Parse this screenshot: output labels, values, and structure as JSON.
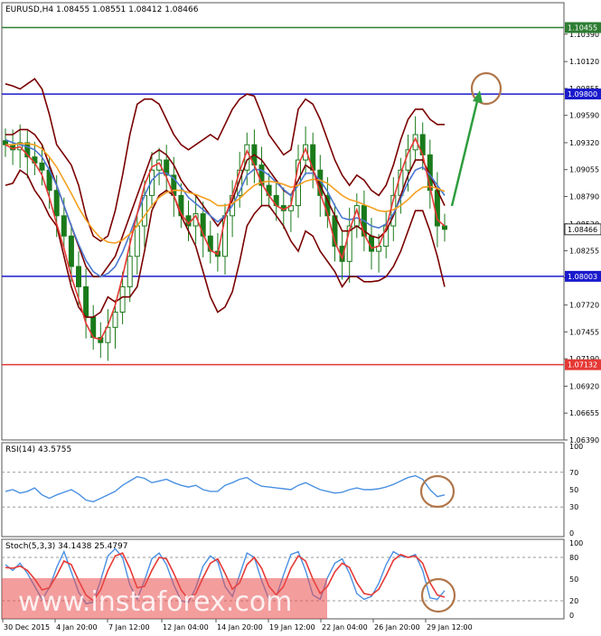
{
  "chart_data": {
    "type": "line",
    "title": "EURUSD,H4  1.08455 1.08551 1.08412 1.08466",
    "symbol": "EURUSD,H4",
    "ohlc": [
      "1.08455",
      "1.08551",
      "1.08412",
      "1.08466"
    ],
    "main": {
      "ylim": [
        1.0639,
        1.107
      ],
      "tick_labels": [
        "1.10390",
        "1.10120",
        "1.09855",
        "1.09590",
        "1.09320",
        "1.09055",
        "1.08790",
        "1.08520",
        "1.08255",
        "1.07990",
        "1.07720",
        "1.07455",
        "1.07190",
        "1.06920",
        "1.06655",
        "1.06390"
      ],
      "hlines": [
        {
          "value": 1.10455,
          "label": "1.10455",
          "color": "#2e7d32"
        },
        {
          "value": 1.098,
          "label": "1.09800",
          "color": "#1a1acc"
        },
        {
          "value": 1.08003,
          "label": "1.08003",
          "color": "#1a1acc"
        },
        {
          "value": 1.07132,
          "label": "1.07132",
          "color": "#e53935"
        }
      ],
      "current_price": {
        "value": 1.08466,
        "label": "1.08466"
      },
      "close_series": [
        1.093,
        1.0925,
        1.0932,
        1.0918,
        1.0912,
        1.0905,
        1.0885,
        1.086,
        1.084,
        1.081,
        1.079,
        1.076,
        1.074,
        1.0735,
        1.075,
        1.0765,
        1.079,
        1.082,
        1.085,
        1.088,
        1.0905,
        1.0915,
        1.09,
        1.088,
        1.086,
        1.085,
        1.0862,
        1.084,
        1.0825,
        1.082,
        1.086,
        1.088,
        1.0905,
        1.093,
        1.091,
        1.089,
        1.088,
        1.087,
        1.0865,
        1.087,
        1.0915,
        1.093,
        1.0905,
        1.088,
        1.086,
        1.083,
        1.0815,
        1.085,
        1.087,
        1.084,
        1.0825,
        1.083,
        1.085,
        1.088,
        1.0905,
        1.0925,
        1.094,
        1.092,
        1.0885,
        1.085,
        1.08466
      ],
      "series": [
        {
          "name": "",
          "color": "#7a0000",
          "values": [
            1.094,
            1.094,
            1.0945,
            1.0945,
            1.094,
            1.093,
            1.091,
            1.089,
            1.087,
            1.085,
            1.083,
            1.081,
            1.08,
            1.08,
            1.081,
            1.082,
            1.084,
            1.086,
            1.088,
            1.09,
            1.092,
            1.0925,
            1.092,
            1.091,
            1.0895,
            1.0885,
            1.088,
            1.087,
            1.086,
            1.085,
            1.086,
            1.0875,
            1.0895,
            1.0915,
            1.092,
            1.0915,
            1.0905,
            1.0895,
            1.0885,
            1.088,
            1.0895,
            1.091,
            1.0905,
            1.089,
            1.0875,
            1.086,
            1.0845,
            1.0845,
            1.085,
            1.0845,
            1.084,
            1.0838,
            1.0845,
            1.086,
            1.088,
            1.09,
            1.0915,
            1.0915,
            1.09,
            1.0885,
            1.087
          ]
        },
        {
          "name": "",
          "color": "#7a0000",
          "values": [
            1.099,
            1.0988,
            1.0985,
            1.099,
            1.0995,
            1.0985,
            1.096,
            1.093,
            1.092,
            1.091,
            1.089,
            1.086,
            1.084,
            1.0835,
            1.084,
            1.0865,
            1.09,
            1.094,
            1.097,
            1.0975,
            1.0975,
            1.097,
            1.0955,
            1.094,
            1.093,
            1.0925,
            1.093,
            1.0935,
            1.094,
            1.0935,
            1.095,
            1.0965,
            1.0975,
            1.098,
            1.0978,
            1.096,
            1.094,
            1.093,
            1.092,
            1.0925,
            1.0965,
            1.0975,
            1.097,
            1.0955,
            1.0935,
            1.0915,
            1.09,
            1.089,
            1.09,
            1.0895,
            1.0885,
            1.088,
            1.089,
            1.091,
            1.0935,
            1.0955,
            1.0965,
            1.0965,
            1.0955,
            1.095,
            1.095
          ]
        },
        {
          "name": "",
          "color": "#7a0000",
          "values": [
            1.089,
            1.0892,
            1.0905,
            1.09,
            1.0885,
            1.0875,
            1.086,
            1.085,
            1.082,
            1.079,
            1.077,
            1.076,
            1.076,
            1.0765,
            1.078,
            1.0775,
            1.078,
            1.078,
            1.079,
            1.0825,
            1.0865,
            1.088,
            1.0885,
            1.088,
            1.086,
            1.0845,
            1.083,
            1.0805,
            1.078,
            1.0765,
            1.077,
            1.0785,
            1.0815,
            1.085,
            1.0862,
            1.087,
            1.087,
            1.086,
            1.085,
            1.0835,
            1.0825,
            1.0845,
            1.084,
            1.0825,
            1.0815,
            1.0805,
            1.079,
            1.08,
            1.08,
            1.0795,
            1.0795,
            1.0796,
            1.08,
            1.081,
            1.0825,
            1.0845,
            1.0865,
            1.0865,
            1.0845,
            1.082,
            1.079
          ]
        },
        {
          "name": "",
          "color": "#4a78d0",
          "values": [
            1.0935,
            1.0932,
            1.093,
            1.0928,
            1.0925,
            1.0918,
            1.0905,
            1.089,
            1.087,
            1.085,
            1.0832,
            1.0816,
            1.0805,
            1.08,
            1.0803,
            1.081,
            1.0824,
            1.0842,
            1.0862,
            1.088,
            1.0895,
            1.0902,
            1.0902,
            1.0897,
            1.0888,
            1.0878,
            1.0872,
            1.0866,
            1.086,
            1.0854,
            1.086,
            1.087,
            1.0884,
            1.09,
            1.0906,
            1.0905,
            1.09,
            1.0893,
            1.0886,
            1.088,
            1.089,
            1.0902,
            1.0902,
            1.0895,
            1.0884,
            1.087,
            1.0858,
            1.0856,
            1.0858,
            1.0855,
            1.085,
            1.0848,
            1.0852,
            1.0862,
            1.0877,
            1.0893,
            1.0905,
            1.0908,
            1.09,
            1.089,
            1.088
          ]
        },
        {
          "name": "",
          "color": "#f5a020",
          "values": [
            1.093,
            1.093,
            1.0931,
            1.0931,
            1.093,
            1.0926,
            1.0918,
            1.0908,
            1.0895,
            1.0882,
            1.0868,
            1.0856,
            1.0846,
            1.0838,
            1.0834,
            1.0833,
            1.0836,
            1.0842,
            1.085,
            1.086,
            1.087,
            1.0878,
            1.0883,
            1.0885,
            1.0885,
            1.0883,
            1.0881,
            1.0878,
            1.0875,
            1.087,
            1.087,
            1.0872,
            1.0877,
            1.0884,
            1.089,
            1.0893,
            1.0894,
            1.0893,
            1.0891,
            1.0888,
            1.089,
            1.0894,
            1.0896,
            1.0895,
            1.0892,
            1.0886,
            1.088,
            1.0876,
            1.0874,
            1.0871,
            1.0868,
            1.0865,
            1.0864,
            1.0866,
            1.087,
            1.0876,
            1.0883,
            1.0888,
            1.0889,
            1.0887,
            1.0884
          ]
        },
        {
          "name": "",
          "color": "#e53935",
          "values": [
            1.093,
            1.0926,
            1.0928,
            1.092,
            1.0912,
            1.09,
            1.0878,
            1.0852,
            1.0828,
            1.08,
            1.0778,
            1.0754,
            1.074,
            1.0738,
            1.0752,
            1.0772,
            1.08,
            1.0832,
            1.0862,
            1.089,
            1.0908,
            1.0912,
            1.0898,
            1.088,
            1.0862,
            1.0852,
            1.086,
            1.0842,
            1.0826,
            1.0822,
            1.0858,
            1.088,
            1.0904,
            1.0924,
            1.091,
            1.0892,
            1.088,
            1.087,
            1.0866,
            1.087,
            1.091,
            1.0926,
            1.0906,
            1.0882,
            1.0862,
            1.0834,
            1.0818,
            1.0846,
            1.0866,
            1.0842,
            1.0828,
            1.083,
            1.0848,
            1.0876,
            1.0902,
            1.0922,
            1.0936,
            1.092,
            1.0888,
            1.0856,
            1.085
          ]
        }
      ]
    },
    "rsi": {
      "label": "RSI(14) 43.5755",
      "ylim": [
        0,
        100
      ],
      "tick_labels": [
        "100",
        "70",
        "50",
        "30",
        "0"
      ],
      "levels": [
        70,
        30
      ],
      "values": [
        48,
        50,
        46,
        48,
        52,
        44,
        40,
        44,
        47,
        50,
        45,
        38,
        36,
        40,
        44,
        48,
        55,
        60,
        65,
        63,
        58,
        60,
        62,
        58,
        55,
        53,
        55,
        50,
        48,
        48,
        55,
        58,
        62,
        64,
        58,
        54,
        53,
        52,
        51,
        50,
        55,
        58,
        54,
        50,
        48,
        46,
        47,
        50,
        52,
        50,
        50,
        51,
        53,
        56,
        60,
        64,
        66,
        62,
        50,
        42,
        44
      ]
    },
    "stoch": {
      "label": "Stoch(5,3,3) 34.1438 25.4797",
      "ylim": [
        0,
        100
      ],
      "tick_labels": [
        "100",
        "80",
        "50",
        "20",
        "0"
      ],
      "levels": [
        80,
        20
      ],
      "k": [
        70,
        62,
        72,
        58,
        40,
        22,
        38,
        66,
        88,
        60,
        32,
        16,
        18,
        48,
        82,
        92,
        80,
        42,
        22,
        48,
        78,
        86,
        70,
        42,
        20,
        18,
        38,
        68,
        82,
        74,
        40,
        26,
        56,
        86,
        80,
        48,
        22,
        26,
        56,
        84,
        88,
        62,
        28,
        22,
        52,
        72,
        78,
        58,
        30,
        22,
        26,
        44,
        70,
        88,
        82,
        80,
        84,
        62,
        24,
        22,
        34
      ],
      "d": [
        66,
        65,
        68,
        62,
        50,
        35,
        38,
        55,
        75,
        70,
        48,
        28,
        20,
        35,
        62,
        82,
        86,
        65,
        38,
        40,
        62,
        80,
        78,
        58,
        35,
        22,
        30,
        52,
        72,
        78,
        58,
        36,
        45,
        70,
        80,
        65,
        40,
        28,
        40,
        65,
        82,
        75,
        50,
        30,
        40,
        60,
        72,
        66,
        45,
        30,
        28,
        36,
        55,
        76,
        84,
        80,
        82,
        72,
        45,
        28,
        25
      ]
    },
    "x_labels": [
      "30 Dec 2015",
      "4 Jan 20:00",
      "7 Jan 12:00",
      "12 Jan 04:00",
      "14 Jan 20:00",
      "19 Jan 12:00",
      "22 Jan 04:00",
      "26 Jan 20:00",
      "29 Jan 12:00"
    ],
    "watermark": "www.instaforex.com"
  }
}
